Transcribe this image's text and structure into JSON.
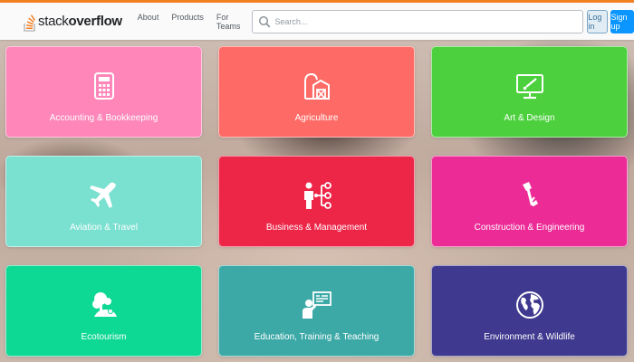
{
  "header": {
    "logo": {
      "light": "stack",
      "bold": "overflow",
      "icon": "stackoverflow-logo-icon"
    },
    "nav": [
      {
        "label": "About"
      },
      {
        "label": "Products"
      },
      {
        "label": "For Teams"
      }
    ],
    "search": {
      "placeholder": "Search...",
      "value": "",
      "icon": "search-icon"
    },
    "login_label": "Log in",
    "signup_label": "Sign up",
    "accent_color": "#f48024"
  },
  "tiles": [
    {
      "label": "Accounting & Bookkeeping",
      "icon": "calculator-icon",
      "color": "#fe86b9"
    },
    {
      "label": "Agriculture",
      "icon": "barn-icon",
      "color": "#fe6b66"
    },
    {
      "label": "Art & Design",
      "icon": "monitor-icon",
      "color": "#4cd03d"
    },
    {
      "label": "Aviation & Travel",
      "icon": "airplane-icon",
      "color": "#7ae0d0"
    },
    {
      "label": "Business & Management",
      "icon": "org-chart-icon",
      "color": "#ed2648"
    },
    {
      "label": "Construction & Engineering",
      "icon": "crane-icon",
      "color": "#ec2b97"
    },
    {
      "label": "Ecotourism",
      "icon": "tree-icon",
      "color": "#0dd894"
    },
    {
      "label": "Education, Training & Teaching",
      "icon": "teacher-board-icon",
      "color": "#3ca9a7"
    },
    {
      "label": "Environment & Wildlife",
      "icon": "globe-icon",
      "color": "#3f3a8f"
    }
  ]
}
